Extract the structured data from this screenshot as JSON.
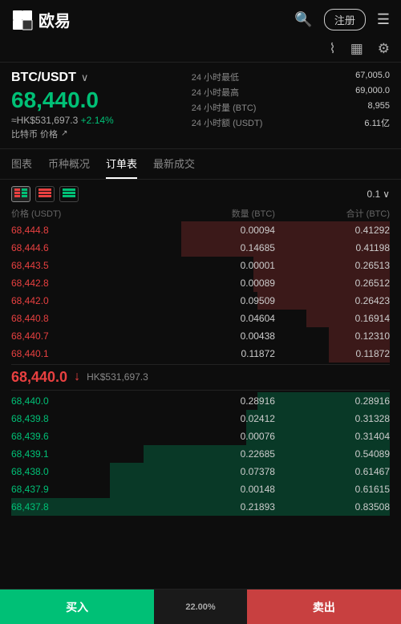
{
  "header": {
    "logo_text": "欧易",
    "register_label": "注册",
    "search_icon": "🔍",
    "menu_icon": "☰"
  },
  "sub_header": {
    "chart_icon": "📈",
    "grid_icon": "▦",
    "settings_icon": "⚙"
  },
  "pair": {
    "name": "BTC/USDT",
    "main_price": "68,440.0",
    "hk_price": "≈HK$531,697.3",
    "change_pct": "+2.14%",
    "coin_label": "比特币 价格",
    "stats": [
      {
        "label": "24 小时最低",
        "value": "67,005.0"
      },
      {
        "label": "24 小时最高",
        "value": "69,000.0"
      },
      {
        "label": "24 小时量 (BTC)",
        "value": "8,955"
      },
      {
        "label": "24 小时额 (USDT)",
        "value": "6.11亿"
      }
    ]
  },
  "tabs": [
    {
      "label": "图表",
      "active": false
    },
    {
      "label": "币种概况",
      "active": false
    },
    {
      "label": "订单表",
      "active": true
    },
    {
      "label": "最新成交",
      "active": false
    }
  ],
  "orderbook": {
    "precision": "0.1",
    "col_headers": {
      "price": "价格 (USDT)",
      "qty": "数量 (BTC)",
      "total": "合计 (BTC)"
    },
    "sells": [
      {
        "price": "68,444.8",
        "qty": "0.00094",
        "total": "0.41292",
        "bar_pct": 55
      },
      {
        "price": "68,444.6",
        "qty": "0.14685",
        "total": "0.41198",
        "bar_pct": 55
      },
      {
        "price": "68,443.5",
        "qty": "0.00001",
        "total": "0.26513",
        "bar_pct": 36
      },
      {
        "price": "68,442.8",
        "qty": "0.00089",
        "total": "0.26512",
        "bar_pct": 36
      },
      {
        "price": "68,442.0",
        "qty": "0.09509",
        "total": "0.26423",
        "bar_pct": 35
      },
      {
        "price": "68,440.8",
        "qty": "0.04604",
        "total": "0.16914",
        "bar_pct": 22
      },
      {
        "price": "68,440.7",
        "qty": "0.00438",
        "total": "0.12310",
        "bar_pct": 16
      },
      {
        "price": "68,440.1",
        "qty": "0.11872",
        "total": "0.11872",
        "bar_pct": 16
      }
    ],
    "mid_price": "68,440.0",
    "mid_hk": "HK$531,697.3",
    "buys": [
      {
        "price": "68,440.0",
        "qty": "0.28916",
        "total": "0.28916",
        "bar_pct": 35
      },
      {
        "price": "68,439.8",
        "qty": "0.02412",
        "total": "0.31328",
        "bar_pct": 38
      },
      {
        "price": "68,439.6",
        "qty": "0.00076",
        "total": "0.31404",
        "bar_pct": 38
      },
      {
        "price": "68,439.1",
        "qty": "0.22685",
        "total": "0.54089",
        "bar_pct": 65
      },
      {
        "price": "68,438.0",
        "qty": "0.07378",
        "total": "0.61467",
        "bar_pct": 74
      },
      {
        "price": "68,437.9",
        "qty": "0.00148",
        "total": "0.61615",
        "bar_pct": 74
      },
      {
        "price": "68,437.8",
        "qty": "0.21893",
        "total": "0.83508",
        "bar_pct": 100
      }
    ]
  },
  "bottom": {
    "buy_label": "买入",
    "sell_label": "卖出",
    "pct_label": "22.00%"
  }
}
